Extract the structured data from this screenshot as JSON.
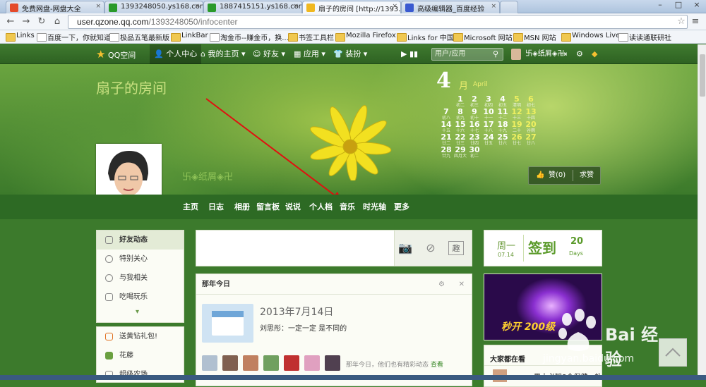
{
  "browser": {
    "tabs": [
      {
        "title": "免费网盘-网盘大全",
        "fav_color": "#e44a2a",
        "x_label": "×"
      },
      {
        "title": "1393248050.ys168.com",
        "fav_color": "#2a9a2a",
        "x_label": "×"
      },
      {
        "title": "1887415151.ys168.com",
        "fav_color": "#2a9a2a",
        "x_label": "×"
      },
      {
        "title": "扇子的房间 [http://1393…",
        "fav_color": "#f0b820",
        "x_label": "×"
      },
      {
        "title": "高级编辑器_百度经验",
        "fav_color": "#3a5ad0",
        "x_label": "×"
      }
    ],
    "window_controls": [
      "–",
      "□",
      "×"
    ],
    "nav": {
      "back": "←",
      "forward": "→",
      "reload": "↻",
      "home": "⌂"
    },
    "url": {
      "host": "user.qzone.qq.com",
      "path": "/1393248050/infocenter"
    },
    "star": "☆",
    "menu": "≡",
    "bookmarks": [
      {
        "label": "Links",
        "kind": "folder"
      },
      {
        "label": "百度一下，你就知道",
        "kind": "page"
      },
      {
        "label": "极品五笔最新版",
        "kind": "page"
      },
      {
        "label": "LinkBar",
        "kind": "folder"
      },
      {
        "label": "淘金币--赚金币，换...",
        "kind": "page"
      },
      {
        "label": "书签工具栏",
        "kind": "folder"
      },
      {
        "label": "Mozilla Firefox",
        "kind": "folder"
      },
      {
        "label": "Links for 中国",
        "kind": "folder"
      },
      {
        "label": "Microsoft 网站",
        "kind": "folder"
      },
      {
        "label": "MSN 网站",
        "kind": "folder"
      },
      {
        "label": "Windows Live",
        "kind": "folder"
      },
      {
        "label": "读读通联研社",
        "kind": "page"
      }
    ]
  },
  "qzone_bar": {
    "logo": "QQ空间",
    "items": [
      "个人中心",
      "我的主页 ▾",
      "好友 ▾",
      "应用 ▾",
      "装扮 ▾"
    ],
    "search_placeholder": "用户/应用",
    "user": "卐◈纸屑◈卍"
  },
  "banner": {
    "title": "扇子的房间",
    "nickname": "卐◈纸屑◈卍",
    "calendar": {
      "month": "4",
      "month_cn": "月",
      "month_en": "April",
      "days": [
        {
          "d": "1",
          "l": "初二"
        },
        {
          "d": "2",
          "l": "初三"
        },
        {
          "d": "3",
          "l": "初四"
        },
        {
          "d": "4",
          "l": "初五"
        },
        {
          "d": "5",
          "l": "清明"
        },
        {
          "d": "6",
          "l": "初七"
        },
        {
          "d": "7",
          "l": "初八"
        },
        {
          "d": "8",
          "l": "初九"
        },
        {
          "d": "9",
          "l": "初十"
        },
        {
          "d": "10",
          "l": "十一"
        },
        {
          "d": "11",
          "l": "十二"
        },
        {
          "d": "12",
          "l": "十三"
        },
        {
          "d": "13",
          "l": "十四"
        },
        {
          "d": "14",
          "l": "十五"
        },
        {
          "d": "15",
          "l": "十六"
        },
        {
          "d": "16",
          "l": "十七"
        },
        {
          "d": "17",
          "l": "十八"
        },
        {
          "d": "18",
          "l": "十九"
        },
        {
          "d": "19",
          "l": "二十"
        },
        {
          "d": "20",
          "l": "谷雨"
        },
        {
          "d": "21",
          "l": "廿二"
        },
        {
          "d": "22",
          "l": "廿三"
        },
        {
          "d": "23",
          "l": "廿四"
        },
        {
          "d": "24",
          "l": "廿五"
        },
        {
          "d": "25",
          "l": "廿六"
        },
        {
          "d": "26",
          "l": "廿七"
        },
        {
          "d": "27",
          "l": "廿八"
        },
        {
          "d": "28",
          "l": "廿九"
        },
        {
          "d": "29",
          "l": "四月大"
        },
        {
          "d": "30",
          "l": "初二"
        }
      ]
    },
    "like_label": "赞(0)",
    "ask_like_label": "求赞"
  },
  "profile_nav": [
    "主页",
    "日志",
    "相册",
    "留言板",
    "说说",
    "个人档",
    "音乐",
    "时光轴",
    "更多"
  ],
  "left_nav": [
    "好友动态",
    "特别关心",
    "与我相关",
    "吃喝玩乐"
  ],
  "left_nav2": [
    "送黄钻礼包!",
    "花藤",
    "超级农场"
  ],
  "today": {
    "header": "那年今日",
    "date": "2013年7月14日",
    "quote": "刘思彤：一定一定 是不同的",
    "more_text": "那年今日，他们也有精彩动态",
    "more_link": "查看"
  },
  "signin": {
    "weekday": "周一",
    "date": "07.14",
    "label": "签到",
    "days": "20",
    "days_unit": "Days"
  },
  "watching": "大家都在看",
  "watching_item": "男士必知8个保健，补",
  "game_text": "秒开 200级",
  "watermark": {
    "text": "Bai 经验",
    "url": "jingyan.baidu.com"
  }
}
